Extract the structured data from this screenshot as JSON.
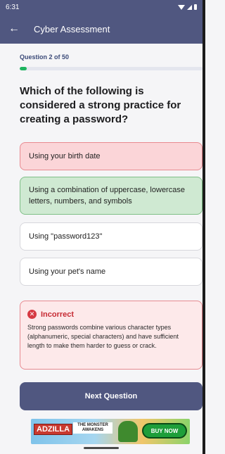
{
  "status_bar": {
    "time": "6:31",
    "icons": [
      "wifi-icon",
      "signal-icon",
      "battery-icon"
    ]
  },
  "app_bar": {
    "back_icon": "arrow-left-icon",
    "title": "Cyber Assessment"
  },
  "progress": {
    "label": "Question 2 of 50",
    "fraction": 0.04
  },
  "question": {
    "text": "Which of the following is considered a strong practice for creating a password?"
  },
  "options": [
    {
      "text": "Using your birth date",
      "state": "incorrect-selected"
    },
    {
      "text": "Using a combination of uppercase, lowercase letters, numbers, and symbols",
      "state": "correct"
    },
    {
      "text": "Using \"password123\"",
      "state": "neutral"
    },
    {
      "text": "Using your pet's name",
      "state": "neutral"
    }
  ],
  "feedback": {
    "icon": "x-circle-icon",
    "title": "Incorrect",
    "text": "Strong passwords combine various character types (alphanumeric, special characters) and have sufficient length to make them harder to guess or crack."
  },
  "next_button": {
    "label": "Next Question"
  },
  "ad": {
    "brand": "ADZILLA",
    "tagline": "THE MONSTER AWAKENS",
    "cta": "BUY NOW"
  },
  "colors": {
    "primary": "#505780",
    "progress": "#1eb45f",
    "correct_bg": "#cfe9d2",
    "incorrect_bg": "#fbd5d8",
    "error": "#c62a33"
  }
}
